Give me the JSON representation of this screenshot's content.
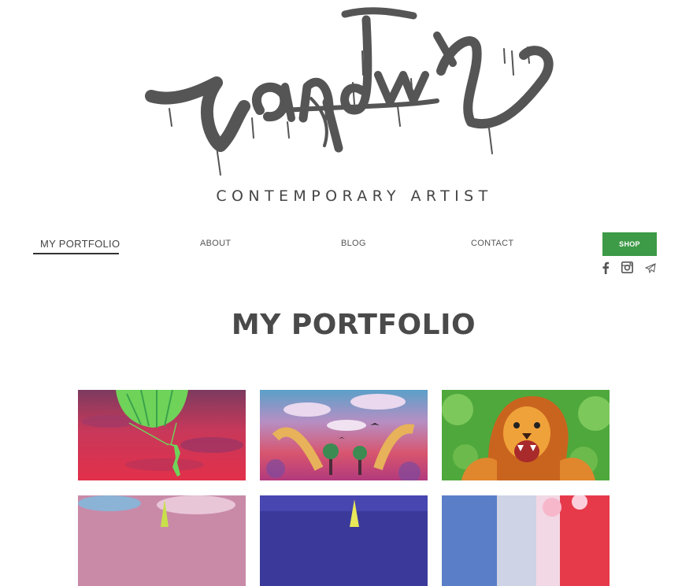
{
  "header": {
    "logo_text": "Zandwy",
    "tagline": "CONTEMPORARY ARTIST"
  },
  "nav": {
    "items": [
      {
        "label": "MY PORTFOLIO",
        "active": true
      },
      {
        "label": "ABOUT"
      },
      {
        "label": "BLOG"
      },
      {
        "label": "CONTACT"
      }
    ],
    "shop_label": "SHOP"
  },
  "social": [
    "facebook-icon",
    "instagram-icon",
    "paper-plane-icon"
  ],
  "main": {
    "title": "MY PORTFOLIO"
  },
  "gallery": [
    {
      "name": "parachute-artwork"
    },
    {
      "name": "landscape-artwork"
    },
    {
      "name": "lion-artwork"
    },
    {
      "name": "artwork-4"
    },
    {
      "name": "artwork-5"
    },
    {
      "name": "artwork-6"
    }
  ],
  "colors": {
    "accent": "#3d9a47",
    "text": "#555555",
    "logo": "#555555"
  }
}
